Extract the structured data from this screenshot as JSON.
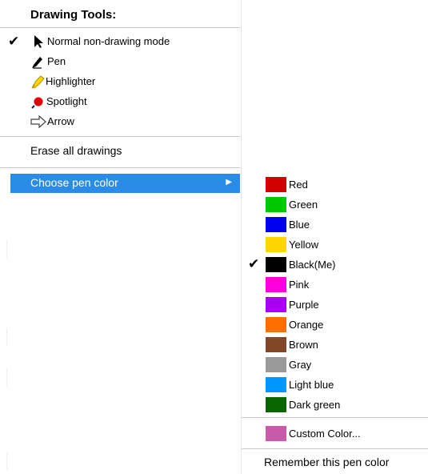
{
  "menu": {
    "header": "Drawing Tools:",
    "tools": [
      {
        "label": "Normal non-drawing mode",
        "icon": "cursor-arrow-icon",
        "checked": true
      },
      {
        "label": "Pen",
        "icon": "pen-icon",
        "checked": false
      },
      {
        "label": "Highlighter",
        "icon": "highlighter-icon",
        "checked": false
      },
      {
        "label": "Spotlight",
        "icon": "spotlight-icon",
        "checked": false
      },
      {
        "label": "Arrow",
        "icon": "arrow-outline-icon",
        "checked": false
      }
    ],
    "erase_label": "Erase all drawings",
    "choose_color_label": "Choose pen color",
    "submenu_arrow": "▶",
    "check_glyph": "✔"
  },
  "submenu": {
    "colors": [
      {
        "label": "Red",
        "hex": "#d40000",
        "checked": false
      },
      {
        "label": "Green",
        "hex": "#00c800",
        "checked": false
      },
      {
        "label": "Blue",
        "hex": "#0000f0",
        "checked": false
      },
      {
        "label": "Yellow",
        "hex": "#ffd700",
        "checked": false
      },
      {
        "label": "Black(Me)",
        "hex": "#000000",
        "checked": true
      },
      {
        "label": "Pink",
        "hex": "#ff00dc",
        "checked": false
      },
      {
        "label": "Purple",
        "hex": "#a800f0",
        "checked": false
      },
      {
        "label": "Orange",
        "hex": "#ff6e00",
        "checked": false
      },
      {
        "label": "Brown",
        "hex": "#804828",
        "checked": false
      },
      {
        "label": "Gray",
        "hex": "#9a9a9a",
        "checked": false
      },
      {
        "label": "Light blue",
        "hex": "#0096ff",
        "checked": false
      },
      {
        "label": "Dark green",
        "hex": "#0a6400",
        "checked": false
      }
    ],
    "custom": {
      "label": "Custom Color...",
      "hex": "#c85aa8"
    },
    "remember_label": "Remember this pen color"
  },
  "colors": {
    "highlight": "#2b8ce8",
    "separator": "#c8c8c8"
  }
}
